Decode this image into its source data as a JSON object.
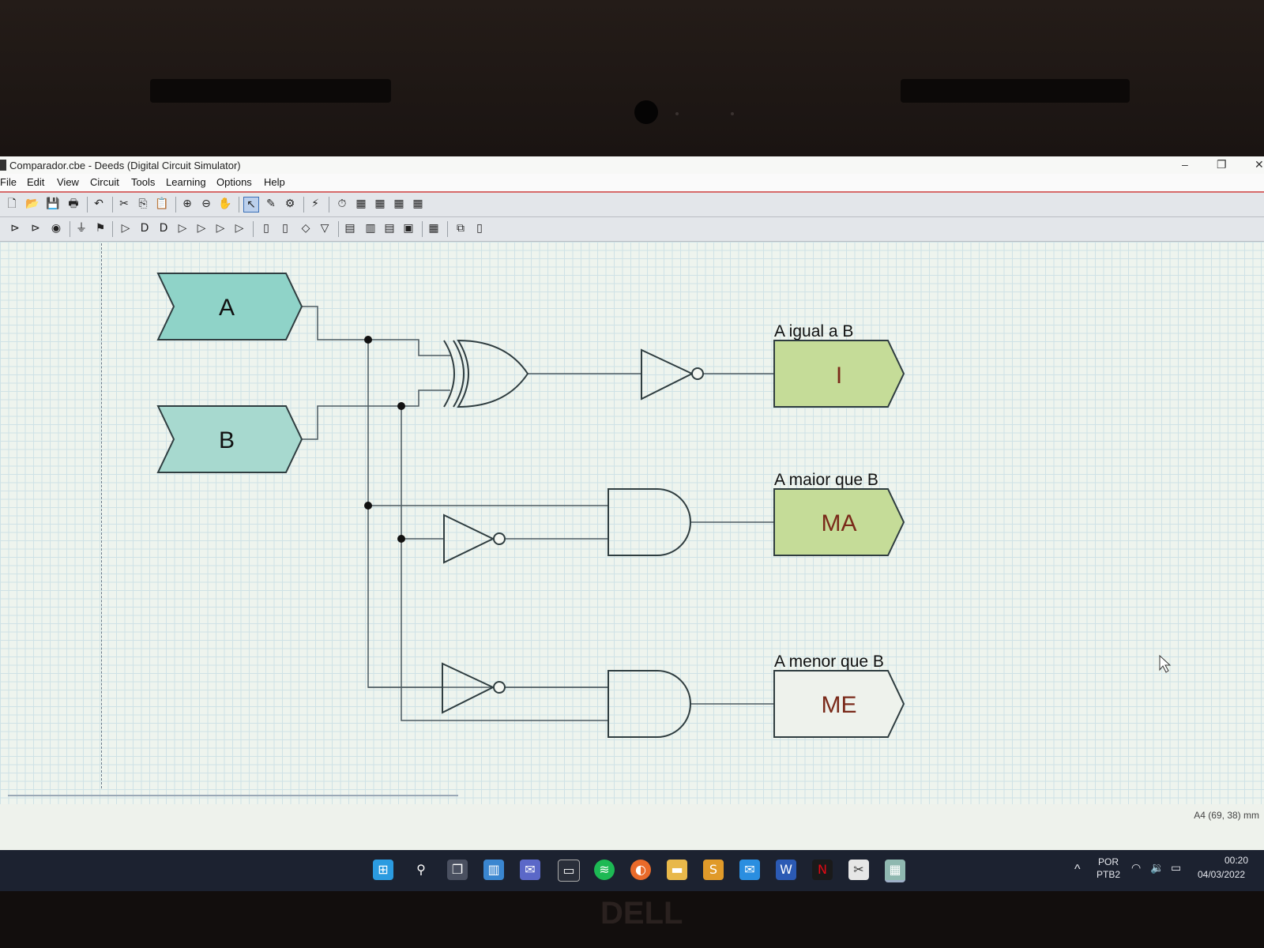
{
  "window": {
    "title": "Comparador.cbe - Deeds (Digital Circuit Simulator)"
  },
  "menu": [
    "File",
    "Edit",
    "View",
    "Circuit",
    "Tools",
    "Learning",
    "Options",
    "Help"
  ],
  "circuit": {
    "inputs": [
      {
        "label": "A",
        "color": "#8fd3c8"
      },
      {
        "label": "B",
        "color": "#a7d9cf"
      }
    ],
    "outputs": [
      {
        "caption": "A  igual a B",
        "value": "I",
        "color": "#c5dc98"
      },
      {
        "caption": "A maior que B",
        "value": "MA",
        "color": "#c5dc98"
      },
      {
        "caption": "A menor que B",
        "value": "ME",
        "color": "#eef2ec"
      }
    ],
    "gates": [
      "xor-gate",
      "not-gate",
      "and-gate",
      "not-gate",
      "and-gate",
      "not-gate"
    ]
  },
  "statusbar": {
    "coords": "A4 (69, 38) mm"
  },
  "taskbar": {
    "lang": "POR",
    "layout": "PTB2",
    "time": "00:20",
    "date": "04/03/2022"
  },
  "brand": "DELL",
  "colors": {
    "wire": "#4c5a60",
    "junction": "#111111"
  }
}
